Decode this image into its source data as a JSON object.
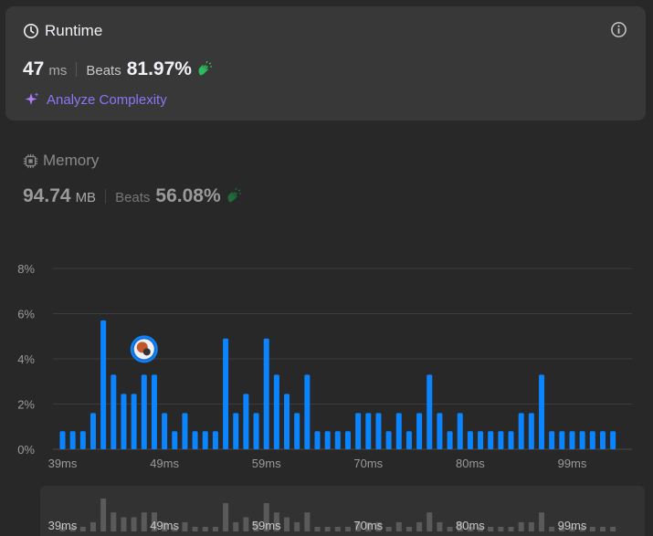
{
  "runtime": {
    "title": "Runtime",
    "value": "47",
    "unit": "ms",
    "beats_label": "Beats",
    "beats_value": "81.97%",
    "analyze_label": "Analyze Complexity"
  },
  "memory": {
    "title": "Memory",
    "value": "94.74",
    "unit": "MB",
    "beats_label": "Beats",
    "beats_value": "56.08%"
  },
  "colors": {
    "bar": "#0a84ff",
    "mini_bar": "#5a5a5a",
    "accent_purple": "#8a78f5",
    "clap_green": "#2cbb5d"
  },
  "chart_data": {
    "type": "bar",
    "y_ticks": [
      "8%",
      "6%",
      "4%",
      "2%",
      "0%"
    ],
    "ylim": [
      0,
      8
    ],
    "x_tick_labels": [
      "39ms",
      "49ms",
      "59ms",
      "70ms",
      "80ms",
      "99ms"
    ],
    "x_tick_bar_index": [
      0,
      10,
      20,
      30,
      40,
      50
    ],
    "marker_bar_index": 8,
    "values": [
      0.8,
      0.8,
      0.8,
      1.6,
      5.7,
      3.3,
      2.45,
      2.45,
      3.3,
      3.3,
      1.6,
      0.8,
      1.6,
      0.8,
      0.8,
      0.8,
      4.9,
      1.6,
      2.45,
      1.6,
      4.9,
      3.3,
      2.45,
      1.6,
      3.3,
      0.8,
      0.8,
      0.8,
      0.8,
      1.6,
      1.6,
      1.6,
      0.8,
      1.6,
      0.8,
      1.6,
      3.3,
      1.6,
      0.8,
      1.6,
      0.8,
      0.8,
      0.8,
      0.8,
      0.8,
      1.6,
      1.6,
      3.3,
      0.8,
      0.8,
      0.8,
      0.8,
      0.8,
      0.8,
      0.8
    ]
  }
}
